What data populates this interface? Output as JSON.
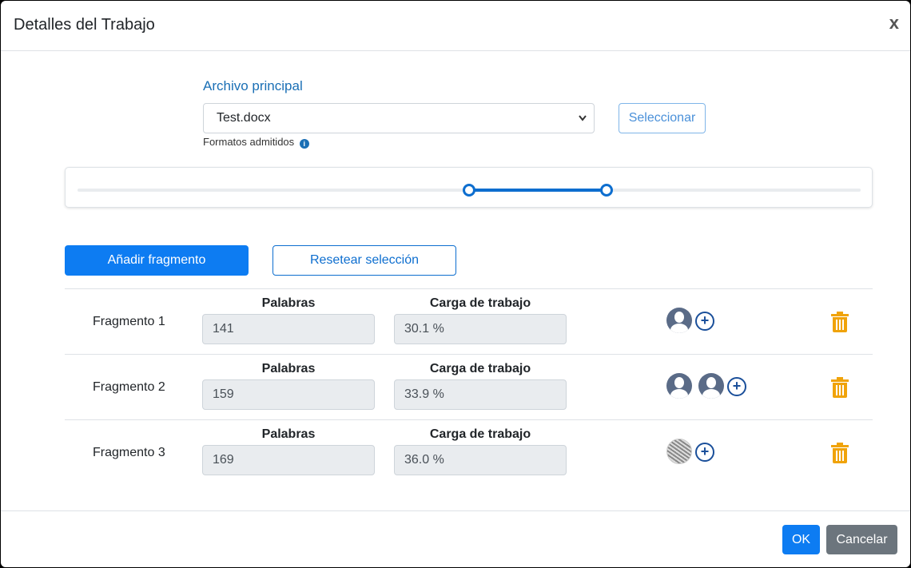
{
  "dialog": {
    "title": "Detalles del Trabajo",
    "close_label": "x"
  },
  "file": {
    "label": "Archivo principal",
    "selected": "Test.docx",
    "select_button": "Seleccionar",
    "formats_text": "Formatos admitidos",
    "info_icon": "info-circle-icon"
  },
  "slider": {
    "handles_percent": [
      50,
      67.5
    ]
  },
  "actions": {
    "add_fragment": "Añadir fragmento",
    "reset_selection": "Resetear selección"
  },
  "fragments": [
    {
      "label": "Fragmento 1",
      "words_header": "Palabras",
      "words": "141",
      "load_header": "Carga de trabajo",
      "load": "30.1 %",
      "avatars": [
        "user-avatar-icon"
      ]
    },
    {
      "label": "Fragmento 2",
      "words_header": "Palabras",
      "words": "159",
      "load_header": "Carga de trabajo",
      "load": "33.9 %",
      "avatars": [
        "user-avatar-icon",
        "user-avatar-icon"
      ]
    },
    {
      "label": "Fragmento 3",
      "words_header": "Palabras",
      "words": "169",
      "load_header": "Carga de trabajo",
      "load": "36.0 %",
      "avatars": [
        "photo-avatar"
      ]
    }
  ],
  "footer": {
    "ok": "OK",
    "cancel": "Cancelar"
  },
  "colors": {
    "primary": "#0d7cf2",
    "secondary": "#6c757d",
    "trash": "#f0a30a"
  }
}
